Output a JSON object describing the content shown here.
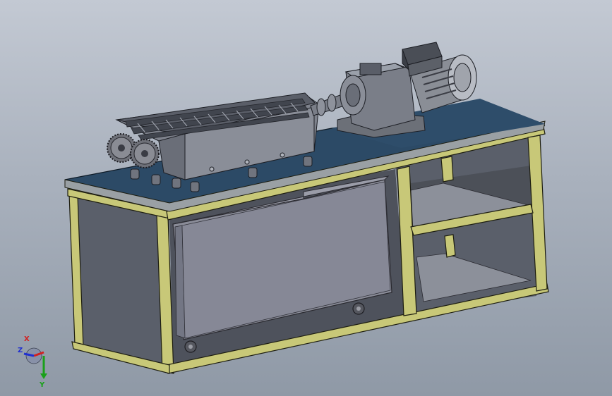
{
  "viewport": {
    "background_top": "#c3c9d3",
    "background_bottom": "#8f99a6"
  },
  "model": {
    "frame_color": "#c8c878",
    "frame_edge": "#1d1d10",
    "panel_color": "#606570",
    "table_top_color": "#2c4a66",
    "bin_color": "#8a8c98",
    "machine_color": "#7e828c",
    "motor_color": "#8a8e96"
  },
  "triad": {
    "x_label": "X",
    "y_label": "Y",
    "z_label": "Z",
    "x_color": "#d22020",
    "y_color": "#1aa01a",
    "z_color": "#2030d0"
  }
}
